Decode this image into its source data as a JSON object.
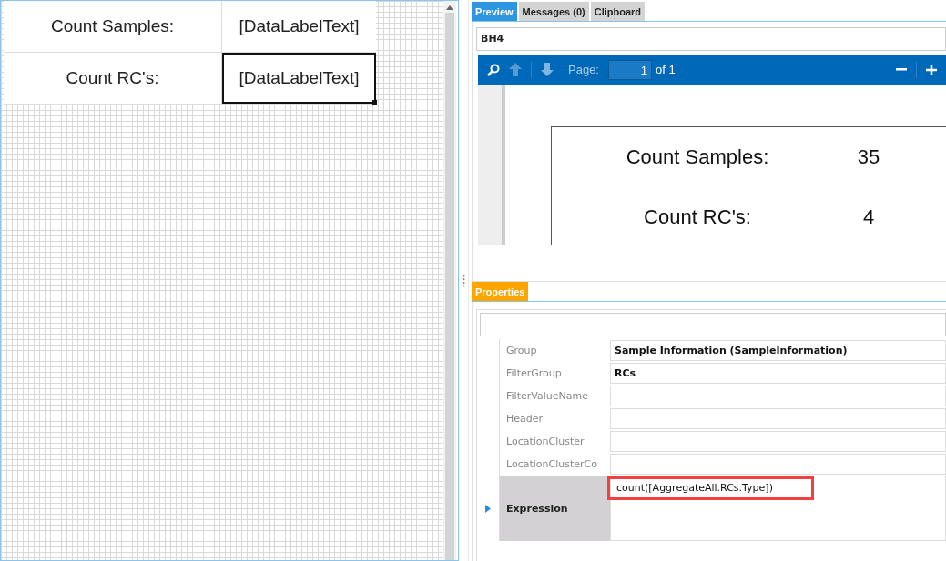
{
  "designer": {
    "rows": [
      {
        "label": "Count Samples:",
        "value": "[DataLabelText]",
        "selected": false
      },
      {
        "label": "Count RC's:",
        "value": "[DataLabelText]",
        "selected": true
      }
    ]
  },
  "tabs": [
    {
      "label": "Preview",
      "selected": true
    },
    {
      "label": "Messages (0)",
      "selected": false
    },
    {
      "label": "Clipboard",
      "selected": false
    }
  ],
  "report_name": "BH4",
  "toolbar": {
    "page_label": "Page:",
    "page": "1",
    "page_count": "of 1"
  },
  "preview_rows": [
    {
      "label": "Count Samples:",
      "value": "35"
    },
    {
      "label": "Count RC's:",
      "value": "4"
    }
  ],
  "properties_tab": {
    "label": "Properties",
    "selected": true
  },
  "properties": [
    {
      "name": "Group",
      "value": "Sample Information (SampleInformation)",
      "selected": false
    },
    {
      "name": "FilterGroup",
      "value": "RCs",
      "selected": false
    },
    {
      "name": "FilterValueName",
      "selected": false
    },
    {
      "name": "Header",
      "selected": false
    },
    {
      "name": "LocationCluster",
      "selected": false
    },
    {
      "name": "LocationClusterCo",
      "selected": false
    },
    {
      "name": "Expression",
      "value": "count([AggregateAll.RCs.Type])",
      "selected": true,
      "highlighted": true
    }
  ]
}
